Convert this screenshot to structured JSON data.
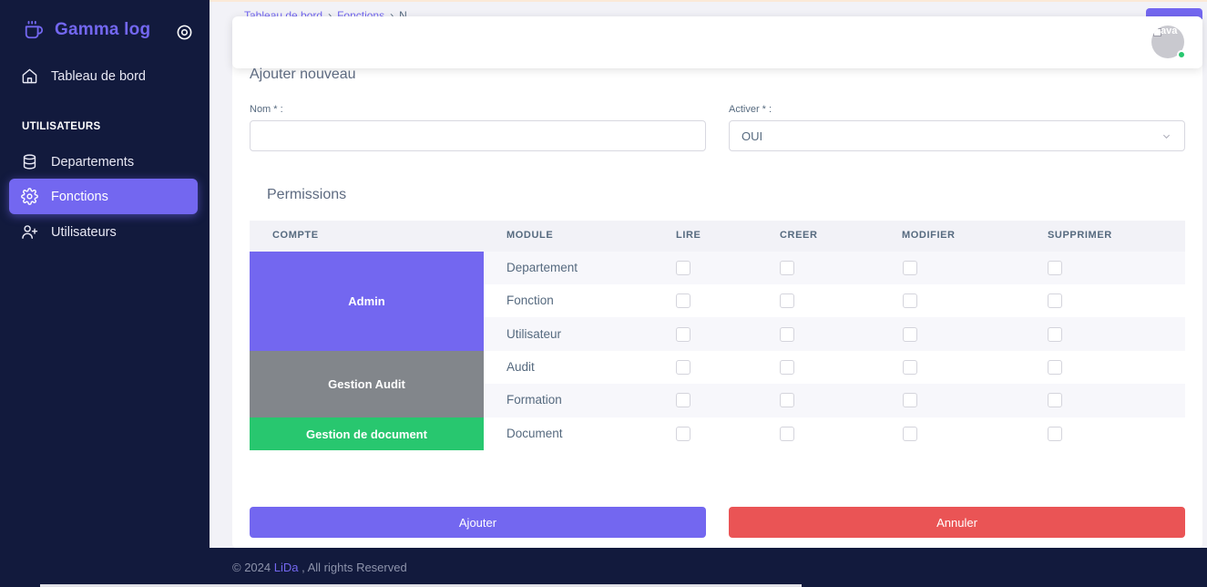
{
  "sidebar": {
    "brand": "Gamma log",
    "items": [
      {
        "label": "Tableau de bord",
        "icon": "home-icon"
      },
      {
        "label": "Departements",
        "icon": "database-icon"
      },
      {
        "label": "Fonctions",
        "icon": "gear-icon",
        "active": true
      },
      {
        "label": "Utilisateurs",
        "icon": "user-plus-icon"
      }
    ],
    "section_title": "UTILISATEURS"
  },
  "breadcrumb": {
    "item1": "Tableau de bord",
    "item2": "Fonctions",
    "current": "N"
  },
  "form": {
    "title": "Ajouter nouveau",
    "nom_label": "Nom * :",
    "nom_value": "",
    "activer_label": "Activer * :",
    "activer_value": "OUI"
  },
  "permissions": {
    "title": "Permissions",
    "headers": [
      "COMPTE",
      "MODULE",
      "LIRE",
      "CREER",
      "MODIFIER",
      "SUPPRIMER"
    ],
    "groups": [
      {
        "name": "Admin",
        "color": "#7367f0",
        "modules": [
          "Departement",
          "Fonction",
          "Utilisateur"
        ]
      },
      {
        "name": "Gestion Audit",
        "color": "#82868b",
        "modules": [
          "Audit",
          "Formation"
        ]
      },
      {
        "name": "Gestion de document",
        "color": "#28c76f",
        "modules": [
          "Document"
        ]
      }
    ]
  },
  "buttons": {
    "submit": "Ajouter",
    "cancel": "Annuler"
  },
  "footer": {
    "copyright": "© 2024 ",
    "brand": "LiDa",
    "rest": " , All rights Reserved"
  },
  "avatar": {
    "alt": "ava"
  },
  "colors": {
    "accent": "#7367f0",
    "danger": "#ea5455",
    "success": "#28c76f",
    "sidebar": "#121a3d"
  }
}
